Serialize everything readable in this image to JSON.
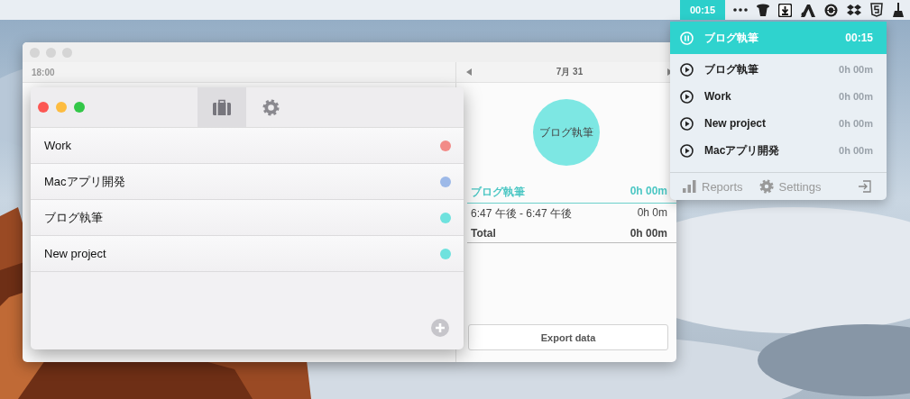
{
  "menu_bar": {
    "timer": "00:15"
  },
  "back_window": {
    "time_label": "18:00",
    "date": "7月 31",
    "chart_label": "ブログ執筆",
    "summary": {
      "project": "ブログ執筆",
      "project_total": "0h 00m",
      "entries": [
        {
          "range": "6:47 午後 - 6:47 午後",
          "duration": "0h 0m"
        }
      ],
      "total_label": "Total",
      "total": "0h 00m"
    },
    "export_button": "Export data"
  },
  "projects_window": {
    "tabs": [
      {
        "kind": "projects",
        "selected": true
      },
      {
        "kind": "settings",
        "selected": false
      }
    ],
    "projects": [
      {
        "name": "Work",
        "color": "#f28b88"
      },
      {
        "name": "Macアプリ開発",
        "color": "#9db9e8"
      },
      {
        "name": "ブログ執筆",
        "color": "#6fe2de"
      },
      {
        "name": "New project",
        "color": "#6fe2de"
      }
    ]
  },
  "menu": {
    "running": {
      "name": "ブログ執筆",
      "time": "00:15"
    },
    "projects": [
      {
        "name": "ブログ執筆",
        "time": "0h 00m"
      },
      {
        "name": "Work",
        "time": "0h 00m"
      },
      {
        "name": "New project",
        "time": "0h 00m"
      },
      {
        "name": "Macアプリ開発",
        "time": "0h 00m"
      }
    ],
    "footer": {
      "reports": "Reports",
      "settings": "Settings"
    }
  }
}
